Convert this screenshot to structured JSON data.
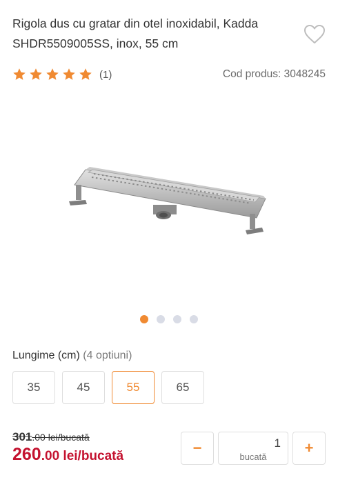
{
  "product": {
    "title": "Rigola dus cu gratar din otel inoxidabil, Kadda SHDR5509005SS, inox, 55 cm",
    "rating_stars": 5,
    "review_count": "(1)",
    "code_label": "Cod produs: 3048245"
  },
  "icons": {
    "favorite": "heart-outline-icon",
    "star": "star-icon"
  },
  "gallery": {
    "dots": [
      {
        "active": true
      },
      {
        "active": false
      },
      {
        "active": false
      },
      {
        "active": false
      }
    ]
  },
  "options": {
    "label": "Lungime (cm)",
    "count_label": "(4 optiuni)",
    "values": [
      "35",
      "45",
      "55",
      "65"
    ],
    "selected": "55"
  },
  "price": {
    "old_main": "301",
    "old_rest": ".00 lei/bucată",
    "new_main": "260",
    "new_rest": ".00 lei/bucată"
  },
  "quantity": {
    "minus_label": "−",
    "plus_label": "+",
    "value": "1",
    "unit": "bucată"
  },
  "colors": {
    "accent": "#f08a32",
    "price": "#c4122f",
    "dot_inactive": "#d9dce6"
  }
}
